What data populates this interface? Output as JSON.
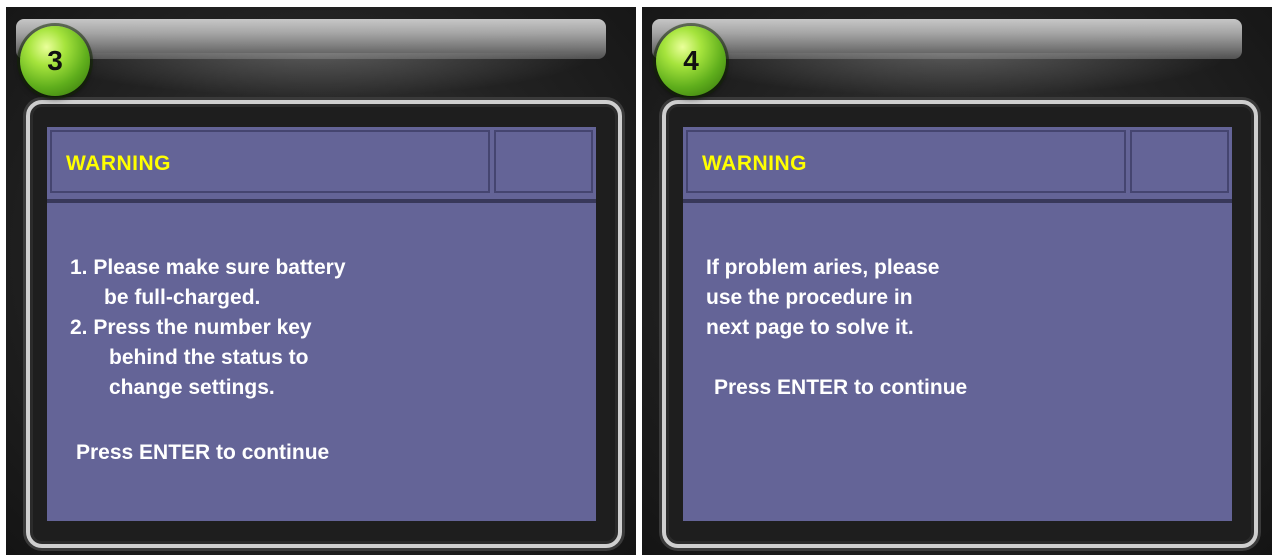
{
  "panels": [
    {
      "step": "3",
      "title": "WARNING",
      "lines": [
        "1. Please make sure battery",
        "be full-charged.",
        "2. Press the number key",
        "behind the status to",
        "change settings."
      ],
      "continue": "Press ENTER to continue"
    },
    {
      "step": "4",
      "title": "WARNING",
      "lines": [
        "If problem aries, please",
        "use the procedure in",
        "next page to solve it."
      ],
      "continue": "Press ENTER to continue"
    }
  ],
  "colors": {
    "screen_bg": "#646497",
    "title_text": "#ffff00",
    "body_text": "#ffffff",
    "badge_green": "#5fae1c"
  }
}
